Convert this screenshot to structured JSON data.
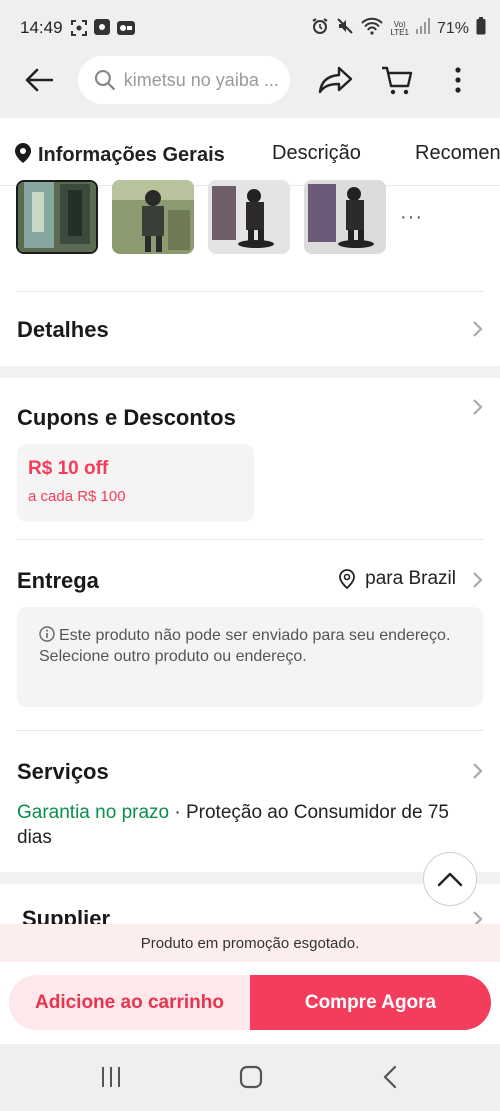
{
  "status_bar": {
    "time": "14:49",
    "battery": "71%",
    "network_top": "Vo)",
    "network_bottom": "LTE1"
  },
  "top_nav": {
    "search_placeholder": "kimetsu no yaiba ...",
    "icons": [
      "back-arrow-icon",
      "search-icon",
      "share-icon",
      "cart-icon",
      "more-vertical-icon"
    ]
  },
  "tabs": [
    {
      "label": "Informações Gerais",
      "active": true
    },
    {
      "label": "Descrição",
      "active": false
    },
    {
      "label": "Recomen",
      "active": false
    }
  ],
  "thumbnails": {
    "count": 4,
    "active_index": 0,
    "more": "···"
  },
  "details": {
    "title": "Detalhes"
  },
  "coupons": {
    "title": "Cupons e Descontos",
    "amount": "R$ 10 off",
    "condition": "a cada R$ 100"
  },
  "delivery": {
    "title": "Entrega",
    "ship_to": "para Brazil",
    "notice_line1": "Este produto não pode ser enviado para seu endereço.",
    "notice_line2": "Selecione outro produto ou endereço."
  },
  "services": {
    "title": "Serviços",
    "guarantee": "Garantia no prazo",
    "separator": " · ",
    "protection": "Proteção ao Consumidor de 75 dias"
  },
  "supplier": {
    "title": "Supplier"
  },
  "promo_notice": "Produto em promoção esgotado.",
  "actions": {
    "add_to_cart": "Adicione ao carrinho",
    "buy_now": "Compre Agora"
  },
  "colors": {
    "accent": "#f43d5c",
    "accent_light": "#fde9ec",
    "green": "#0a8f4b"
  }
}
